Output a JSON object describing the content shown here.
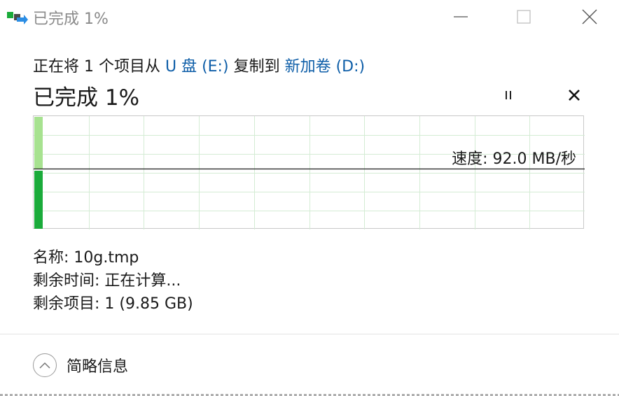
{
  "window": {
    "title": "已完成 1%",
    "icon": "file-copy-icon"
  },
  "copy_line": {
    "prefix": "正在将 1 个项目从",
    "source": "U 盘 (E:)",
    "middle": "复制到",
    "destination": "新加卷 (D:)"
  },
  "status": {
    "big": "已完成 1%",
    "progress_percent": 1
  },
  "graph": {
    "speed_text": "速度: 92.0 MB/秒",
    "speed_mb_s": 92.0
  },
  "details": {
    "name": "名称: 10g.tmp",
    "time_remaining": "剩余时间: 正在计算...",
    "items_remaining": "剩余项目: 1 (9.85 GB)"
  },
  "footer": {
    "toggle_label": "简略信息"
  },
  "colors": {
    "link": "#0e5ea8",
    "progress_dark": "#1aab3a",
    "progress_light": "#a7e290",
    "grid": "#d4ecd4"
  }
}
